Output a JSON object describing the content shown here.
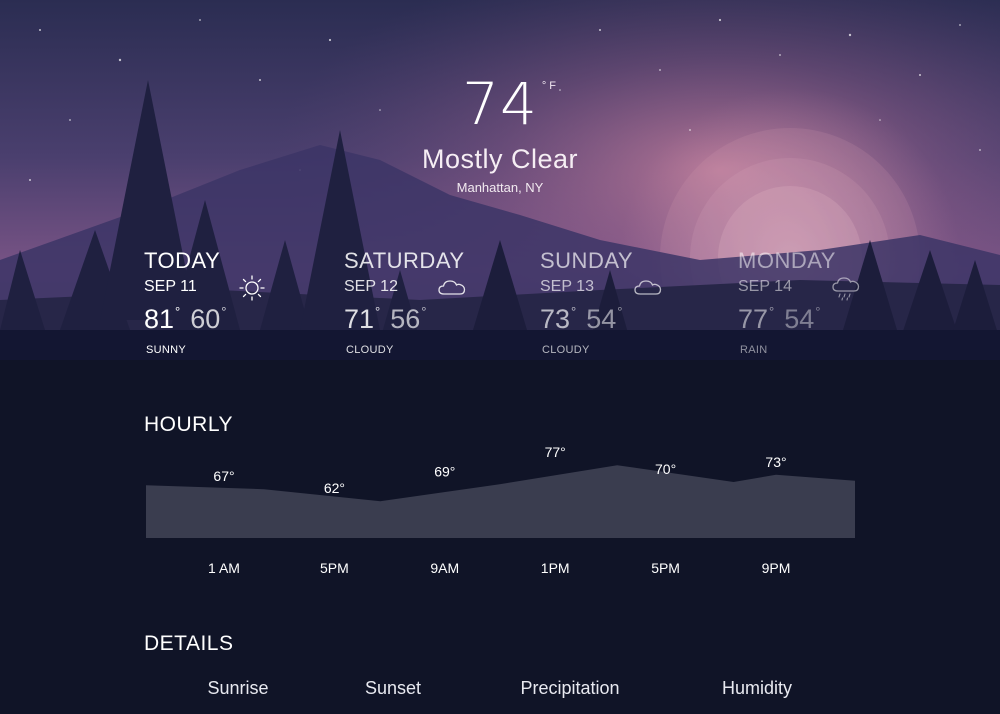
{
  "current": {
    "temperature": "74",
    "unit": "°F",
    "condition": "Mostly Clear",
    "location": "Manhattan, NY"
  },
  "forecast": [
    {
      "day": "TODAY",
      "date": "SEP 11",
      "high": "81",
      "low": "60",
      "condition": "SUNNY",
      "icon": "sun-icon",
      "opacity": 1.0
    },
    {
      "day": "SATURDAY",
      "date": "SEP 12",
      "high": "71",
      "low": "56",
      "condition": "CLOUDY",
      "icon": "cloud-icon",
      "opacity": 0.86
    },
    {
      "day": "SUNDAY",
      "date": "SEP 13",
      "high": "73",
      "low": "54",
      "condition": "CLOUDY",
      "icon": "cloud-icon",
      "opacity": 0.68
    },
    {
      "day": "MONDAY",
      "date": "SEP 14",
      "high": "77",
      "low": "54",
      "condition": "RAIN",
      "icon": "rain-cloud-icon",
      "opacity": 0.52
    }
  ],
  "degree_symbol": "°",
  "hourly": {
    "title": "HOURLY"
  },
  "chart_data": {
    "type": "area",
    "x": [
      "1 AM",
      "5PM",
      "9AM",
      "1PM",
      "5PM",
      "9PM"
    ],
    "values": [
      67,
      62,
      69,
      77,
      70,
      73
    ],
    "value_labels": [
      "67°",
      "62°",
      "69°",
      "77°",
      "70°",
      "73°"
    ],
    "ylim": [
      55,
      85
    ],
    "fill_color": "#3a3d4f"
  },
  "details": {
    "title": "DETAILS",
    "labels": [
      "Sunrise",
      "Sunset",
      "Precipitation",
      "Humidity"
    ]
  },
  "colors": {
    "sky_top": "#2b2d52",
    "sky_mid": "#6a4a78",
    "sky_glow": "#c27a9a",
    "ground": "#101427"
  }
}
